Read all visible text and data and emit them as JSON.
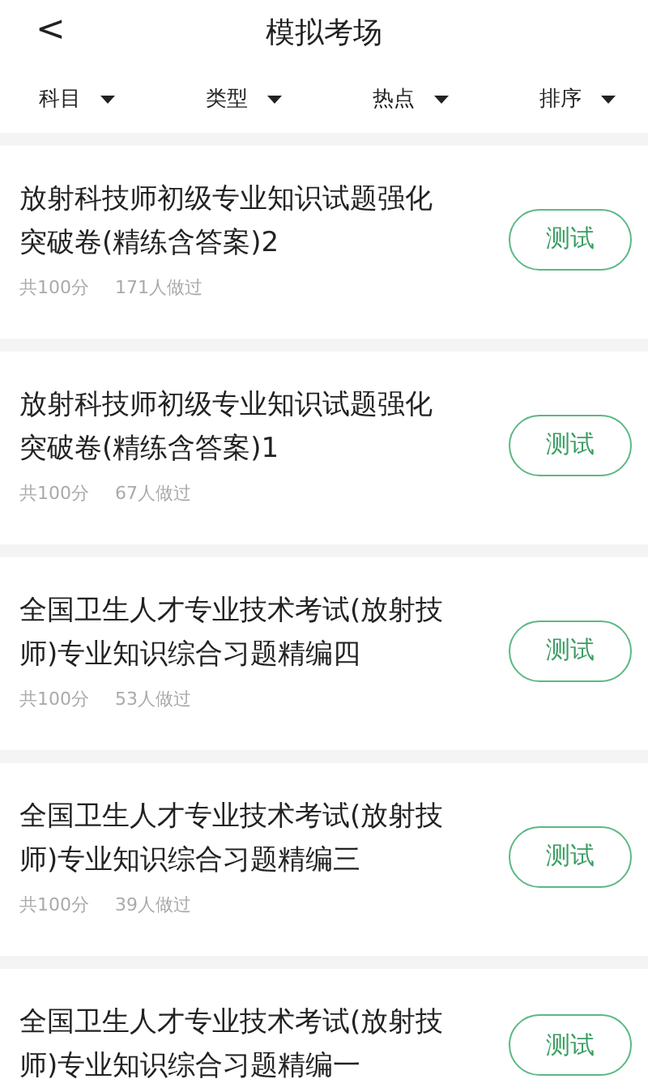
{
  "header": {
    "back": "<",
    "title": "模拟考场"
  },
  "filters": [
    {
      "label": "科目"
    },
    {
      "label": "类型"
    },
    {
      "label": "热点"
    },
    {
      "label": "排序"
    }
  ],
  "exams": [
    {
      "title": "放射科技师初级专业知识试题强化突破卷(精练含答案)2",
      "score": "共100分",
      "count": "171人做过",
      "action": "测试"
    },
    {
      "title": "放射科技师初级专业知识试题强化突破卷(精练含答案)1",
      "score": "共100分",
      "count": "67人做过",
      "action": "测试"
    },
    {
      "title": "全国卫生人才专业技术考试(放射技师)专业知识综合习题精编四",
      "score": "共100分",
      "count": "53人做过",
      "action": "测试"
    },
    {
      "title": "全国卫生人才专业技术考试(放射技师)专业知识综合习题精编三",
      "score": "共100分",
      "count": "39人做过",
      "action": "测试"
    },
    {
      "title": "全国卫生人才专业技术考试(放射技师)专业知识综合习题精编一",
      "action": "测试"
    }
  ]
}
